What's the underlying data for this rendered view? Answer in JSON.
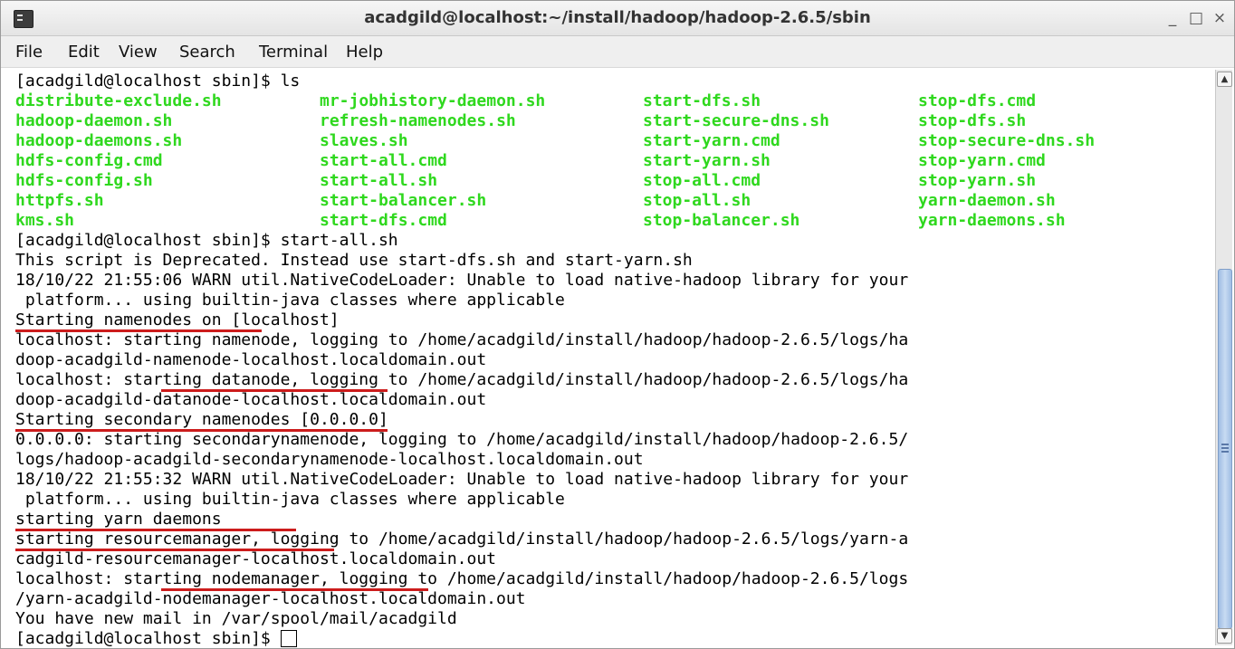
{
  "window": {
    "title": "acadgild@localhost:~/install/hadoop/hadoop-2.6.5/sbin",
    "minimize": "_",
    "maximize": "□",
    "close": "×"
  },
  "menu": [
    "File",
    "Edit",
    "View",
    "Search",
    "Terminal",
    "Help"
  ],
  "terminal": {
    "cmd1": "[acadgild@localhost sbin]$ ls",
    "files": [
      [
        "distribute-exclude.sh",
        "mr-jobhistory-daemon.sh",
        "start-dfs.sh",
        "stop-dfs.cmd"
      ],
      [
        "hadoop-daemon.sh",
        "refresh-namenodes.sh",
        "start-secure-dns.sh",
        "stop-dfs.sh"
      ],
      [
        "hadoop-daemons.sh",
        "slaves.sh",
        "start-yarn.cmd",
        "stop-secure-dns.sh"
      ],
      [
        "hdfs-config.cmd",
        "start-all.cmd",
        "start-yarn.sh",
        "stop-yarn.cmd"
      ],
      [
        "hdfs-config.sh",
        "start-all.sh",
        "stop-all.cmd",
        "stop-yarn.sh"
      ],
      [
        "httpfs.sh",
        "start-balancer.sh",
        "stop-all.sh",
        "yarn-daemon.sh"
      ],
      [
        "kms.sh",
        "start-dfs.cmd",
        "stop-balancer.sh",
        "yarn-daemons.sh"
      ]
    ],
    "output": [
      "[acadgild@localhost sbin]$ start-all.sh",
      "This script is Deprecated. Instead use start-dfs.sh and start-yarn.sh",
      "18/10/22 21:55:06 WARN util.NativeCodeLoader: Unable to load native-hadoop library for your",
      " platform... using builtin-java classes where applicable",
      "Starting namenodes on [localhost]",
      "localhost: starting namenode, logging to /home/acadgild/install/hadoop/hadoop-2.6.5/logs/ha",
      "doop-acadgild-namenode-localhost.localdomain.out",
      "localhost: starting datanode, logging to /home/acadgild/install/hadoop/hadoop-2.6.5/logs/ha",
      "doop-acadgild-datanode-localhost.localdomain.out",
      "Starting secondary namenodes [0.0.0.0]",
      "0.0.0.0: starting secondarynamenode, logging to /home/acadgild/install/hadoop/hadoop-2.6.5/",
      "logs/hadoop-acadgild-secondarynamenode-localhost.localdomain.out",
      "18/10/22 21:55:32 WARN util.NativeCodeLoader: Unable to load native-hadoop library for your",
      " platform... using builtin-java classes where applicable",
      "starting yarn daemons",
      "starting resourcemanager, logging to /home/acadgild/install/hadoop/hadoop-2.6.5/logs/yarn-a",
      "cadgild-resourcemanager-localhost.localdomain.out",
      "localhost: starting nodemanager, logging to /home/acadgild/install/hadoop/hadoop-2.6.5/logs",
      "/yarn-acadgild-nodemanager-localhost.localdomain.out",
      "You have new mail in /var/spool/mail/acadgild"
    ],
    "prompt": "[acadgild@localhost sbin]$ "
  },
  "colors": {
    "file_listing": "#2fd81e",
    "annotation_underline": "#cc1c1c",
    "scrollbar_thumb": "#9fbde4"
  },
  "icons": [
    "terminal-app-icon",
    "minimize-icon",
    "maximize-icon",
    "close-icon",
    "scroll-up-icon",
    "scroll-down-icon"
  ]
}
